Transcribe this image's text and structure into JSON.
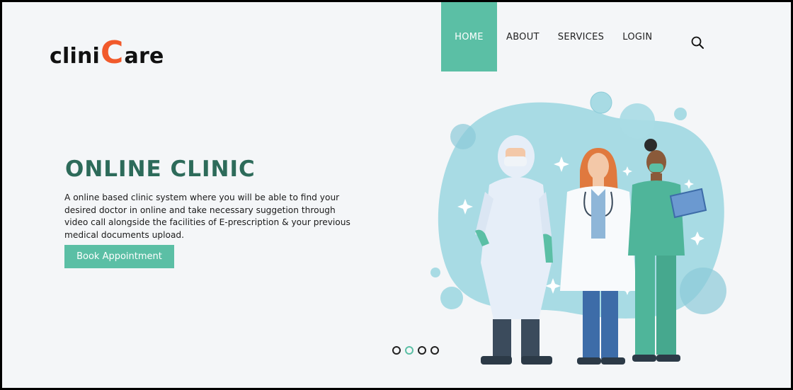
{
  "brand": {
    "part1": "clini",
    "part2": "C",
    "part3": "are",
    "accent_color": "#f15a2b"
  },
  "nav": {
    "items": [
      {
        "label": "HOME",
        "active": true
      },
      {
        "label": "ABOUT",
        "active": false
      },
      {
        "label": "SERVICES",
        "active": false
      },
      {
        "label": "LOGIN",
        "active": false
      }
    ],
    "search_icon": "search-icon",
    "accent_color": "#5bbfa5"
  },
  "hero": {
    "title": "ONLINE CLINIC",
    "description": "A online based clinic system where you will be able to find your desired doctor in online and take necessary suggetion through video call alongside the facilities of E-prescription & your previous medical documents upload.",
    "cta_label": "Book Appointment",
    "title_color": "#2d6b5a"
  },
  "carousel": {
    "count": 4,
    "active_index": 1
  }
}
